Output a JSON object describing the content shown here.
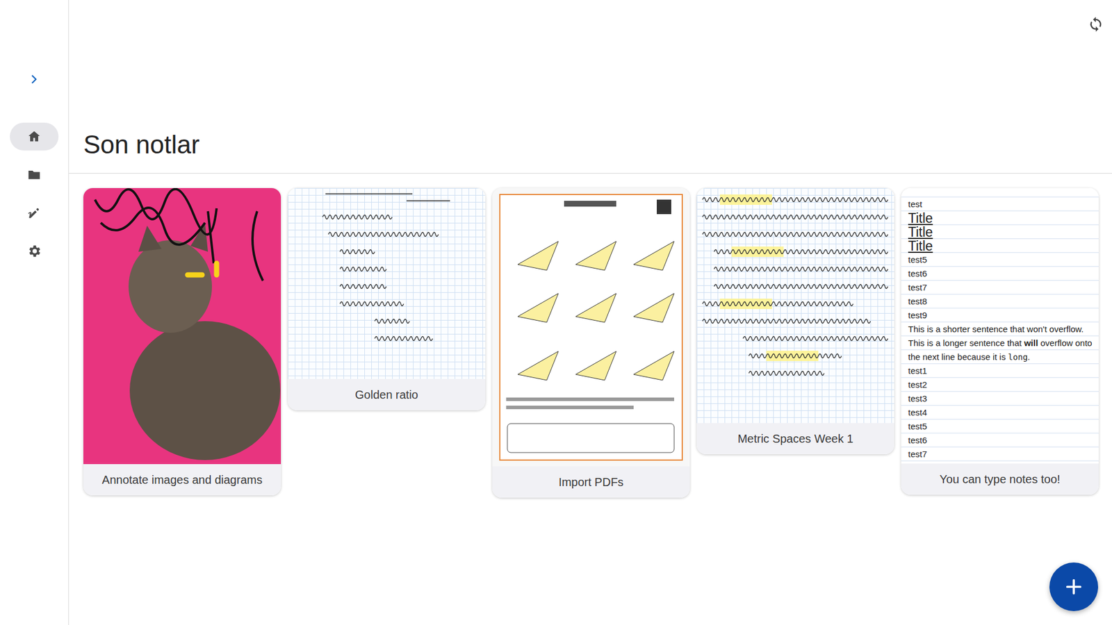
{
  "page": {
    "title": "Son notlar"
  },
  "nav": [
    {
      "selected": true
    },
    {
      "selected": false
    },
    {
      "selected": false
    },
    {
      "selected": false
    }
  ],
  "notes": [
    {
      "title": "Annotate images and diagrams",
      "kind": "photo"
    },
    {
      "title": "Golden ratio",
      "kind": "sketch"
    },
    {
      "title": "Import PDFs",
      "kind": "pdf"
    },
    {
      "title": "Metric Spaces Week 1",
      "kind": "highlighted"
    },
    {
      "title": "You can type notes too!",
      "kind": "typed",
      "lines": [
        {
          "kind": "plain",
          "segments": [
            {
              "text": "test",
              "kind": "plain"
            }
          ]
        },
        {
          "kind": "title",
          "segments": [
            {
              "text": "Title",
              "kind": "plain"
            }
          ]
        },
        {
          "kind": "title",
          "segments": [
            {
              "text": "Title",
              "kind": "plain"
            }
          ]
        },
        {
          "kind": "title",
          "segments": [
            {
              "text": "Title",
              "kind": "plain"
            }
          ]
        },
        {
          "kind": "plain",
          "segments": [
            {
              "text": "test5",
              "kind": "plain"
            }
          ]
        },
        {
          "kind": "plain",
          "segments": [
            {
              "text": "test6",
              "kind": "plain"
            }
          ]
        },
        {
          "kind": "plain",
          "segments": [
            {
              "text": "test7",
              "kind": "plain"
            }
          ]
        },
        {
          "kind": "plain",
          "segments": [
            {
              "text": "test8",
              "kind": "plain"
            }
          ]
        },
        {
          "kind": "plain",
          "segments": [
            {
              "text": "test9",
              "kind": "plain"
            }
          ]
        },
        {
          "kind": "plain",
          "segments": [
            {
              "text": "This is a shorter sentence that won't overflow.",
              "kind": "plain"
            }
          ]
        },
        {
          "kind": "plain",
          "segments": [
            {
              "text": "This is a longer sentence that ",
              "kind": "plain"
            },
            {
              "text": "will",
              "kind": "bold"
            },
            {
              "text": " overflow onto the next line because it is ",
              "kind": "plain"
            },
            {
              "text": "long",
              "kind": "mono"
            },
            {
              "text": ".",
              "kind": "plain"
            }
          ]
        },
        {
          "kind": "plain",
          "segments": [
            {
              "text": "test1",
              "kind": "plain"
            }
          ]
        },
        {
          "kind": "plain",
          "segments": [
            {
              "text": "test2",
              "kind": "plain"
            }
          ]
        },
        {
          "kind": "plain",
          "segments": [
            {
              "text": "test3",
              "kind": "plain"
            }
          ]
        },
        {
          "kind": "plain",
          "segments": [
            {
              "text": "test4",
              "kind": "plain"
            }
          ]
        },
        {
          "kind": "plain",
          "segments": [
            {
              "text": "test5",
              "kind": "plain"
            }
          ]
        },
        {
          "kind": "plain",
          "segments": [
            {
              "text": "test6",
              "kind": "plain"
            }
          ]
        },
        {
          "kind": "plain",
          "segments": [
            {
              "text": "test7",
              "kind": "plain"
            }
          ]
        }
      ]
    }
  ]
}
